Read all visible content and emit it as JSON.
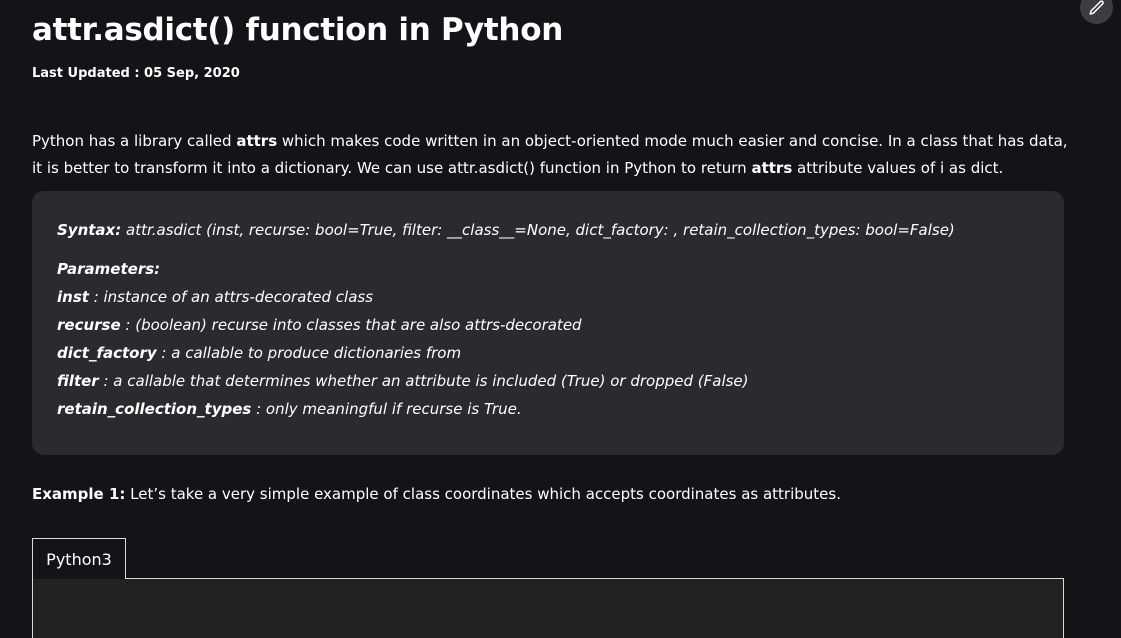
{
  "article": {
    "title": "attr.asdict() function in Python",
    "last_updated": "Last Updated : 05 Sep, 2020",
    "intro": {
      "part1": "Python has a library called ",
      "bold1": "attrs",
      "part2": " which makes code written in an object-oriented mode much easier and concise. In a class that has data, it is better to transform it into a dictionary. We can use attr.asdict() function in Python to return ",
      "bold2": "attrs",
      "part3": " attribute values of i as dict."
    },
    "syntax": {
      "label": "Syntax:",
      "text": " attr.asdict (inst, recurse: bool=True, filter: __class__=None, dict_factory: , retain_collection_types: bool=False)"
    },
    "parameters": {
      "title": "Parameters:",
      "items": [
        {
          "name": "inst",
          "desc": " : instance of an attrs-decorated class"
        },
        {
          "name": "recurse",
          "desc": " : (boolean) recurse into classes that are also attrs-decorated"
        },
        {
          "name": "dict_factory",
          "desc": " : a callable to produce dictionaries from"
        },
        {
          "name": "filter",
          "desc": " : a callable that determines whether an attribute is included (True) or dropped (False)"
        },
        {
          "name": "retain_collection_types",
          "desc": " : only meaningful if recurse is True."
        }
      ]
    },
    "example1": {
      "label": "Example 1:",
      "text": " Let’s take a very simple example of class coordinates which accepts coordinates as attributes."
    },
    "code_tab": "Python3"
  },
  "icons": {
    "edit": "pencil-icon"
  }
}
